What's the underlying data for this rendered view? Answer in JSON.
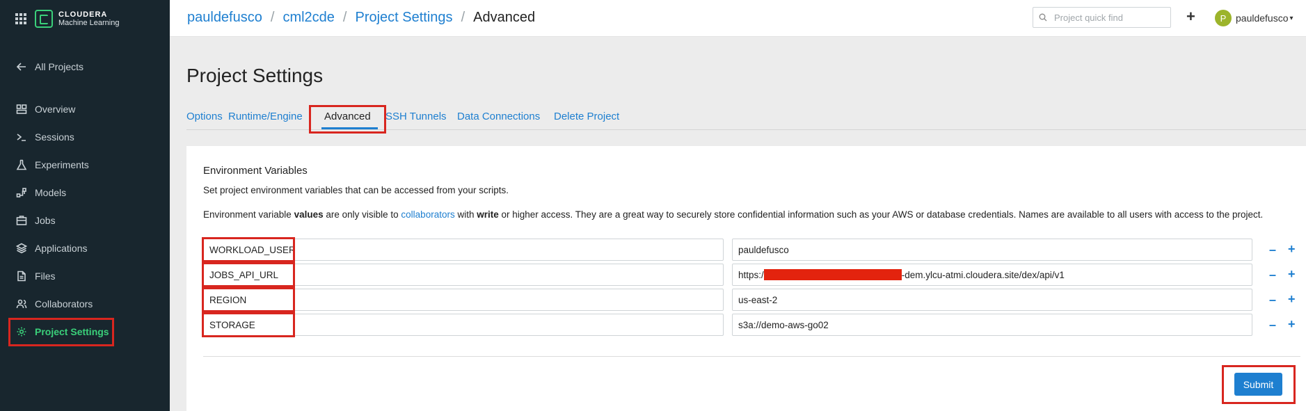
{
  "brand": {
    "name": "CLOUDERA",
    "product": "Machine Learning"
  },
  "sidebar": {
    "back_label": "All Projects",
    "items": [
      {
        "label": "Overview",
        "icon": "overview-icon"
      },
      {
        "label": "Sessions",
        "icon": "terminal-icon"
      },
      {
        "label": "Experiments",
        "icon": "flask-icon"
      },
      {
        "label": "Models",
        "icon": "models-icon"
      },
      {
        "label": "Jobs",
        "icon": "jobs-icon"
      },
      {
        "label": "Applications",
        "icon": "layers-icon"
      },
      {
        "label": "Files",
        "icon": "file-icon"
      },
      {
        "label": "Collaborators",
        "icon": "users-icon"
      },
      {
        "label": "Project Settings",
        "icon": "gear-icon",
        "active": true
      }
    ]
  },
  "breadcrumbs": [
    "pauldefusco",
    "cml2cde",
    "Project Settings",
    "Advanced"
  ],
  "search": {
    "placeholder": "Project quick find"
  },
  "user": {
    "name": "pauldefusco",
    "initial": "P"
  },
  "page": {
    "title": "Project Settings"
  },
  "tabs": [
    {
      "label": "Options"
    },
    {
      "label": "Runtime/Engine"
    },
    {
      "label": "Advanced",
      "active": true
    },
    {
      "label": "SSH Tunnels"
    },
    {
      "label": "Data Connections"
    },
    {
      "label": "Delete Project"
    }
  ],
  "env": {
    "title": "Environment Variables",
    "description": "Set project environment variables that can be accessed from your scripts.",
    "note": {
      "p1": "Environment variable ",
      "b1": "values",
      "p2": " are only visible to ",
      "link": "collaborators",
      "p3": " with ",
      "b2": "write",
      "p4": " or higher access. They are a great way to securely store confidential information such as your AWS or database credentials. Names are available to all users with access to the project."
    },
    "rows": [
      {
        "key": "WORKLOAD_USER",
        "value": "pauldefusco"
      },
      {
        "key": "JOBS_API_URL",
        "value_prefix": "https:/",
        "value_suffix": "-dem.ylcu-atmi.cloudera.site/dex/api/v1"
      },
      {
        "key": "REGION",
        "value": "us-east-2"
      },
      {
        "key": "STORAGE",
        "value": "s3a://demo-aws-go02"
      }
    ],
    "remove_symbol": "–",
    "add_symbol": "+"
  },
  "submit_label": "Submit",
  "colors": {
    "accent": "#1e7fd0",
    "sidebar_bg": "#18262e",
    "active_green": "#3ad07a",
    "highlight_red": "#d8261f"
  }
}
